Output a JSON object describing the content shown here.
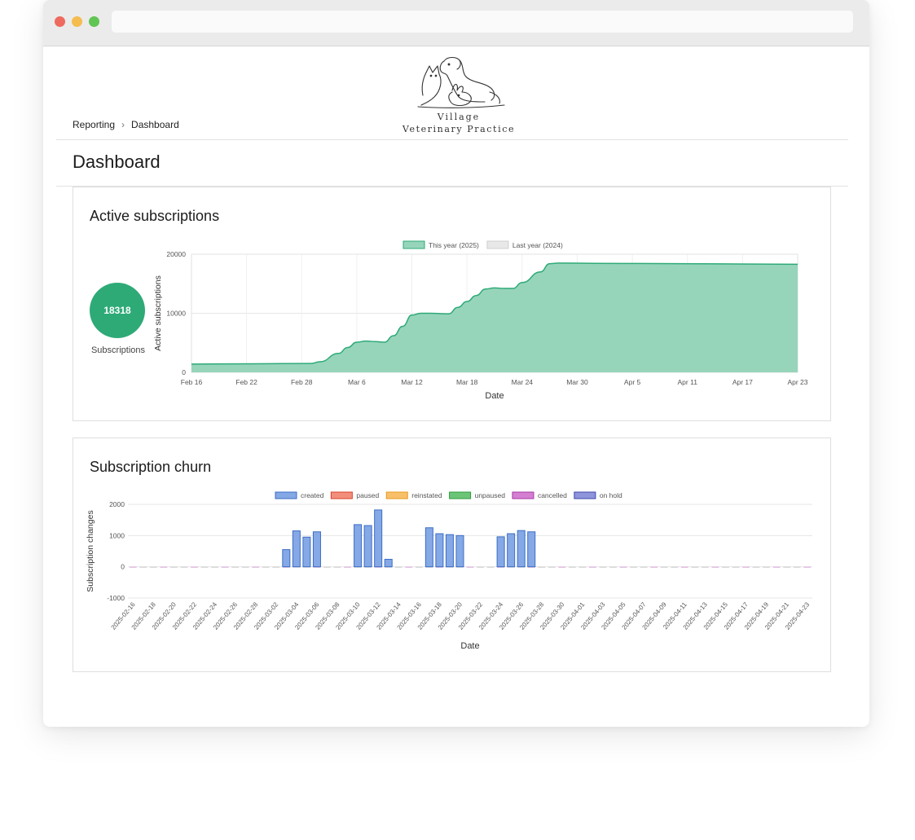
{
  "logo": {
    "line1": "Village",
    "line2": "Veterinary Practice"
  },
  "breadcrumb": {
    "items": [
      "Reporting",
      "Dashboard"
    ]
  },
  "page": {
    "title": "Dashboard"
  },
  "active": {
    "title": "Active subscriptions",
    "kpi_value": "18318",
    "kpi_label": "Subscriptions",
    "kpi_color": "#2eaa77"
  },
  "churn": {
    "title": "Subscription churn"
  },
  "chart_data": [
    {
      "type": "area",
      "legend": [
        {
          "name": "This year (2025)",
          "color": "#2eaa77"
        },
        {
          "name": "Last year (2024)",
          "color": "#dddddd"
        }
      ],
      "xlabel": "Date",
      "ylabel": "Active subscriptions",
      "ylim": [
        0,
        20000
      ],
      "yticks": [
        0,
        10000,
        20000
      ],
      "xticks": [
        "Feb 16",
        "Feb 22",
        "Feb 28",
        "Mar 6",
        "Mar 12",
        "Mar 18",
        "Mar 24",
        "Mar 30",
        "Apr 5",
        "Apr 11",
        "Apr 17",
        "Apr 23"
      ],
      "xdomain": [
        "2025-02-16",
        "2025-04-23"
      ],
      "series": [
        {
          "name": "This year (2025)",
          "points": [
            [
              "2025-02-16",
              1400
            ],
            [
              "2025-02-23",
              1450
            ],
            [
              "2025-03-01",
              1500
            ],
            [
              "2025-03-02",
              1800
            ],
            [
              "2025-03-04",
              3200
            ],
            [
              "2025-03-05",
              4200
            ],
            [
              "2025-03-06",
              5100
            ],
            [
              "2025-03-07",
              5300
            ],
            [
              "2025-03-08",
              5200
            ],
            [
              "2025-03-09",
              5100
            ],
            [
              "2025-03-10",
              6200
            ],
            [
              "2025-03-11",
              7800
            ],
            [
              "2025-03-12",
              9700
            ],
            [
              "2025-03-13",
              10000
            ],
            [
              "2025-03-14",
              10000
            ],
            [
              "2025-03-16",
              9900
            ],
            [
              "2025-03-17",
              11000
            ],
            [
              "2025-03-18",
              12000
            ],
            [
              "2025-03-19",
              13000
            ],
            [
              "2025-03-20",
              14100
            ],
            [
              "2025-03-21",
              14300
            ],
            [
              "2025-03-22",
              14200
            ],
            [
              "2025-03-23",
              14200
            ],
            [
              "2025-03-24",
              15200
            ],
            [
              "2025-03-26",
              17000
            ],
            [
              "2025-03-27",
              18400
            ],
            [
              "2025-03-28",
              18500
            ],
            [
              "2025-04-01",
              18450
            ],
            [
              "2025-04-10",
              18400
            ],
            [
              "2025-04-23",
              18300
            ]
          ]
        }
      ]
    },
    {
      "type": "bar",
      "legend": [
        {
          "name": "created",
          "color": "#85a8e6"
        },
        {
          "name": "paused",
          "color": "#f28f7c"
        },
        {
          "name": "reinstated",
          "color": "#f8c06a"
        },
        {
          "name": "unpaused",
          "color": "#6cc577"
        },
        {
          "name": "cancelled",
          "color": "#d47fd2"
        },
        {
          "name": "on hold",
          "color": "#8e95da"
        }
      ],
      "xlabel": "Date",
      "ylabel": "Subscription changes",
      "ylim": [
        -1000,
        2000
      ],
      "yticks": [
        -1000,
        0,
        1000,
        2000
      ],
      "start_date": "2025-02-16",
      "xtick_labels": [
        "2025-02-16",
        "2025-02-18",
        "2025-02-20",
        "2025-02-22",
        "2025-02-24",
        "2025-02-26",
        "2025-02-28",
        "2025-03-02",
        "2025-03-04",
        "2025-03-06",
        "2025-03-08",
        "2025-03-10",
        "2025-03-12",
        "2025-03-14",
        "2025-03-16",
        "2025-03-18",
        "2025-03-20",
        "2025-03-22",
        "2025-03-24",
        "2025-03-26",
        "2025-03-28",
        "2025-03-30",
        "2025-04-01",
        "2025-04-03",
        "2025-04-05",
        "2025-04-07",
        "2025-04-09",
        "2025-04-11",
        "2025-04-13",
        "2025-04-15",
        "2025-04-17",
        "2025-04-19",
        "2025-04-21",
        "2025-04-23"
      ],
      "created": [
        {
          "date": "2025-03-03",
          "value": 550
        },
        {
          "date": "2025-03-04",
          "value": 1150
        },
        {
          "date": "2025-03-05",
          "value": 950
        },
        {
          "date": "2025-03-06",
          "value": 1120
        },
        {
          "date": "2025-03-10",
          "value": 1350
        },
        {
          "date": "2025-03-11",
          "value": 1320
        },
        {
          "date": "2025-03-12",
          "value": 1820
        },
        {
          "date": "2025-03-13",
          "value": 240
        },
        {
          "date": "2025-03-17",
          "value": 1250
        },
        {
          "date": "2025-03-18",
          "value": 1060
        },
        {
          "date": "2025-03-19",
          "value": 1030
        },
        {
          "date": "2025-03-20",
          "value": 1000
        },
        {
          "date": "2025-03-24",
          "value": 960
        },
        {
          "date": "2025-03-25",
          "value": 1060
        },
        {
          "date": "2025-03-26",
          "value": 1160
        },
        {
          "date": "2025-03-27",
          "value": 1120
        }
      ]
    }
  ]
}
